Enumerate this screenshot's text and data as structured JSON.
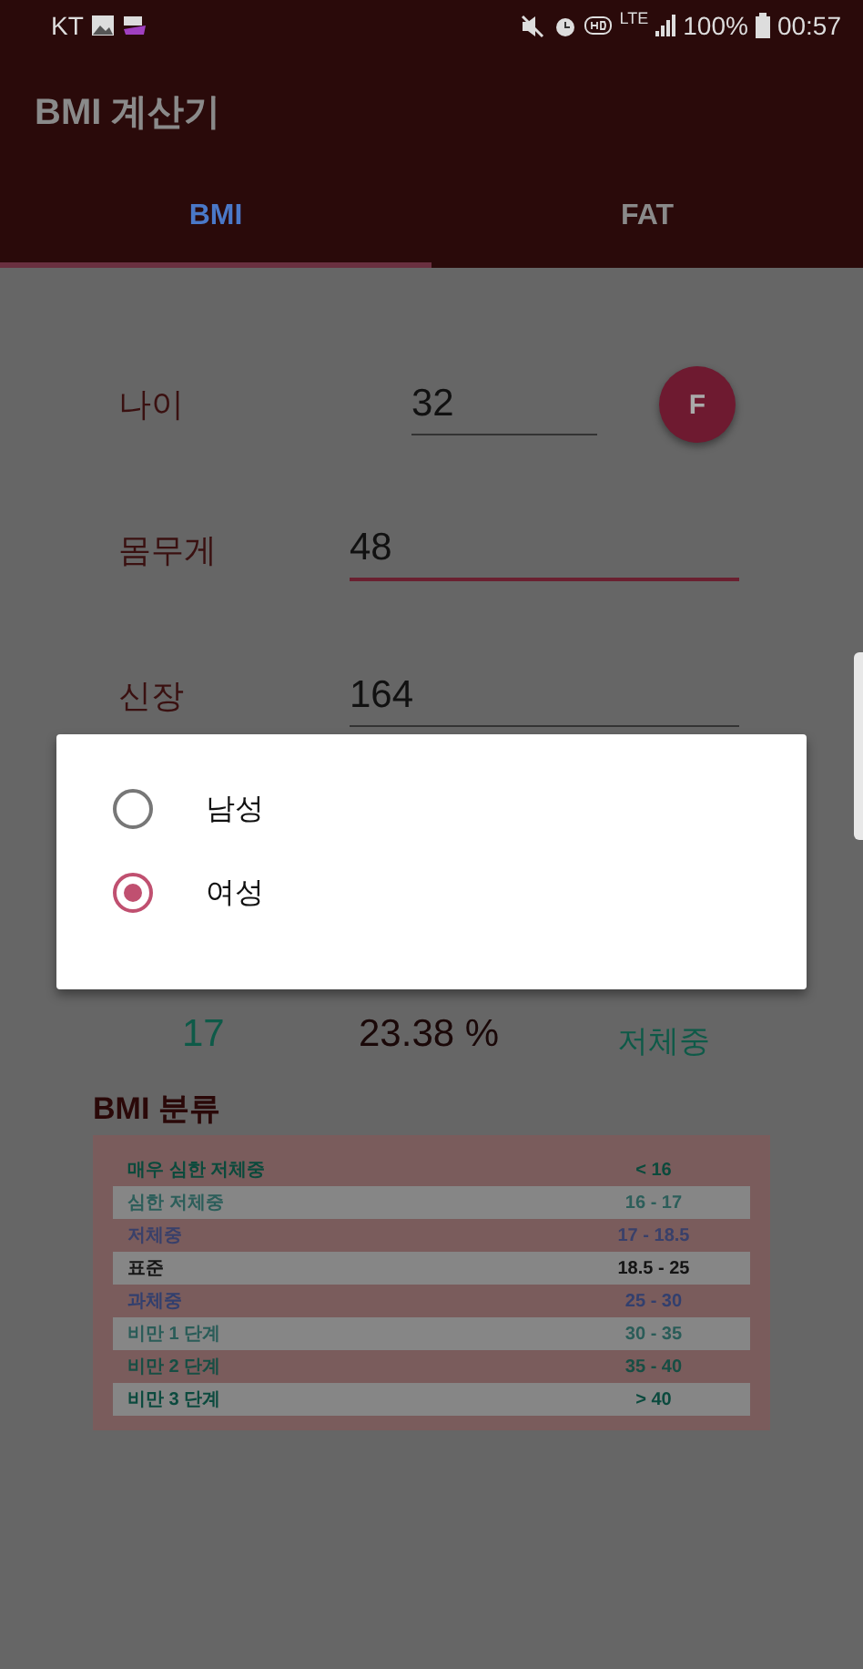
{
  "status_bar": {
    "carrier": "KT",
    "signal_label": "LTE",
    "battery": "100%",
    "time": "00:57"
  },
  "app_bar": {
    "title": "BMI 계산기"
  },
  "tabs": [
    {
      "label": "BMI",
      "selected": true
    },
    {
      "label": "FAT",
      "selected": false
    }
  ],
  "form": {
    "fields": [
      {
        "label": "나이",
        "value": "32",
        "focused": false,
        "kind": "age"
      },
      {
        "label": "몸무게",
        "value": "48",
        "focused": true,
        "kind": "wide"
      },
      {
        "label": "신장",
        "value": "164",
        "focused": false,
        "kind": "wide"
      }
    ],
    "gender_button": "F"
  },
  "results": [
    {
      "text": "17",
      "color": "#0e5a48"
    },
    {
      "text": "23.38 %",
      "color": "#1a0808"
    },
    {
      "text": "저체중",
      "color": "#0e5a48"
    }
  ],
  "classification": {
    "title": "BMI 분류",
    "rows": [
      {
        "name": "매우 심한 저체중",
        "range": "< 16",
        "color": "#0b4a3c"
      },
      {
        "name": "심한 저체중",
        "range": "16 - 17",
        "color": "#2c5e5a"
      },
      {
        "name": "저체중",
        "range": "17 - 18.5",
        "color": "#39406a"
      },
      {
        "name": "표준",
        "range": "18.5 - 25",
        "color": "#141414"
      },
      {
        "name": "과체중",
        "range": "25 - 30",
        "color": "#323f6e"
      },
      {
        "name": "비만 1 단계",
        "range": "30 - 35",
        "color": "#2a5c58"
      },
      {
        "name": "비만 2 단계",
        "range": "35 - 40",
        "color": "#174e44"
      },
      {
        "name": "비만 3 단계",
        "range": "> 40",
        "color": "#0b4a3e"
      }
    ]
  },
  "dialog": {
    "options": [
      {
        "label": "남성",
        "selected": false
      },
      {
        "label": "여성",
        "selected": true
      }
    ]
  }
}
